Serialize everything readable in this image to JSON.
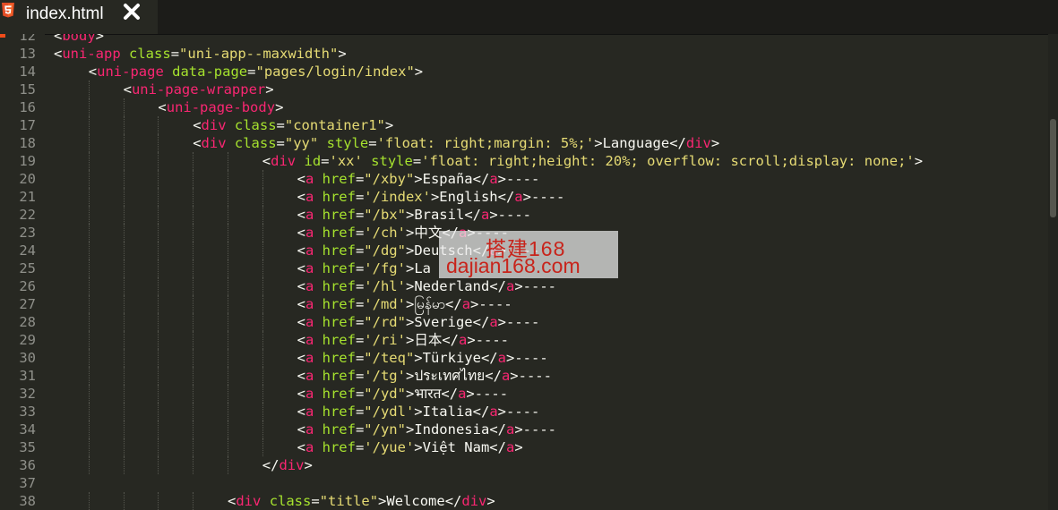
{
  "tab": {
    "title": "index.html",
    "icon": "html5-icon",
    "close_icon": "close-icon"
  },
  "colors": {
    "background": "#272822",
    "tag": "#f92672",
    "attribute": "#a6e22e",
    "string": "#e6db74",
    "text": "#f8f8f2",
    "line_number": "#8f908a"
  },
  "watermark": {
    "line1": "搭建168",
    "line2": "dajian168.com"
  },
  "lines": [
    {
      "n": "12",
      "indent": 0,
      "tokens": [
        [
          "br",
          "<"
        ],
        [
          "tag",
          "body"
        ],
        [
          "br",
          ">"
        ]
      ]
    },
    {
      "n": "13",
      "indent": 0,
      "tokens": [
        [
          "br",
          "<"
        ],
        [
          "tag",
          "uni-app"
        ],
        [
          "t",
          " "
        ],
        [
          "attr",
          "class"
        ],
        [
          "br",
          "="
        ],
        [
          "str",
          "\"uni-app--maxwidth\""
        ],
        [
          "br",
          ">"
        ]
      ]
    },
    {
      "n": "14",
      "indent": 1,
      "tokens": [
        [
          "br",
          "<"
        ],
        [
          "tag",
          "uni-page"
        ],
        [
          "t",
          " "
        ],
        [
          "attr",
          "data-page"
        ],
        [
          "br",
          "="
        ],
        [
          "str",
          "\"pages/login/index\""
        ],
        [
          "br",
          ">"
        ]
      ]
    },
    {
      "n": "15",
      "indent": 2,
      "tokens": [
        [
          "br",
          "<"
        ],
        [
          "tag",
          "uni-page-wrapper"
        ],
        [
          "br",
          ">"
        ]
      ]
    },
    {
      "n": "16",
      "indent": 3,
      "tokens": [
        [
          "br",
          "<"
        ],
        [
          "tag",
          "uni-page-body"
        ],
        [
          "br",
          ">"
        ]
      ]
    },
    {
      "n": "17",
      "indent": 4,
      "tokens": [
        [
          "br",
          "<"
        ],
        [
          "tag",
          "div"
        ],
        [
          "t",
          " "
        ],
        [
          "attr",
          "class"
        ],
        [
          "br",
          "="
        ],
        [
          "str",
          "\"container1\""
        ],
        [
          "br",
          ">"
        ]
      ]
    },
    {
      "n": "18",
      "indent": 4,
      "tokens": [
        [
          "br",
          "<"
        ],
        [
          "tag",
          "div"
        ],
        [
          "t",
          " "
        ],
        [
          "attr",
          "class"
        ],
        [
          "br",
          "="
        ],
        [
          "str",
          "\"yy\""
        ],
        [
          "t",
          " "
        ],
        [
          "attr",
          "style"
        ],
        [
          "br",
          "="
        ],
        [
          "str",
          "'float: right;margin: 5%;'"
        ],
        [
          "br",
          ">"
        ],
        [
          "t",
          "Language"
        ],
        [
          "br",
          "</"
        ],
        [
          "tag",
          "div"
        ],
        [
          "br",
          ">"
        ]
      ]
    },
    {
      "n": "19",
      "indent": 6,
      "tokens": [
        [
          "br",
          "<"
        ],
        [
          "tag",
          "div"
        ],
        [
          "t",
          " "
        ],
        [
          "attr",
          "id"
        ],
        [
          "br",
          "="
        ],
        [
          "str",
          "'xx'"
        ],
        [
          "t",
          " "
        ],
        [
          "attr",
          "style"
        ],
        [
          "br",
          "="
        ],
        [
          "str",
          "'float: right;height: 20%; overflow: scroll;display: none;'"
        ],
        [
          "br",
          ">"
        ]
      ]
    },
    {
      "n": "20",
      "indent": 7,
      "tokens": [
        [
          "br",
          "<"
        ],
        [
          "tag",
          "a"
        ],
        [
          "t",
          " "
        ],
        [
          "attr",
          "href"
        ],
        [
          "br",
          "="
        ],
        [
          "str",
          "\"/xby\""
        ],
        [
          "br",
          ">"
        ],
        [
          "t",
          "España"
        ],
        [
          "br",
          "</"
        ],
        [
          "tag",
          "a"
        ],
        [
          "br",
          ">"
        ],
        [
          "t",
          "----"
        ]
      ]
    },
    {
      "n": "21",
      "indent": 7,
      "tokens": [
        [
          "br",
          "<"
        ],
        [
          "tag",
          "a"
        ],
        [
          "t",
          " "
        ],
        [
          "attr",
          "href"
        ],
        [
          "br",
          "="
        ],
        [
          "str",
          "'/index'"
        ],
        [
          "br",
          ">"
        ],
        [
          "t",
          "English"
        ],
        [
          "br",
          "</"
        ],
        [
          "tag",
          "a"
        ],
        [
          "br",
          ">"
        ],
        [
          "t",
          "----"
        ]
      ]
    },
    {
      "n": "22",
      "indent": 7,
      "tokens": [
        [
          "br",
          "<"
        ],
        [
          "tag",
          "a"
        ],
        [
          "t",
          " "
        ],
        [
          "attr",
          "href"
        ],
        [
          "br",
          "="
        ],
        [
          "str",
          "\"/bx\""
        ],
        [
          "br",
          ">"
        ],
        [
          "t",
          "Brasil"
        ],
        [
          "br",
          "</"
        ],
        [
          "tag",
          "a"
        ],
        [
          "br",
          ">"
        ],
        [
          "t",
          "----"
        ]
      ]
    },
    {
      "n": "23",
      "indent": 7,
      "tokens": [
        [
          "br",
          "<"
        ],
        [
          "tag",
          "a"
        ],
        [
          "t",
          " "
        ],
        [
          "attr",
          "href"
        ],
        [
          "br",
          "="
        ],
        [
          "str",
          "'/ch'"
        ],
        [
          "br",
          ">"
        ],
        [
          "t",
          "中文"
        ],
        [
          "br",
          "</"
        ],
        [
          "tag",
          "a"
        ],
        [
          "br",
          ">"
        ],
        [
          "t",
          "----"
        ]
      ]
    },
    {
      "n": "24",
      "indent": 7,
      "tokens": [
        [
          "br",
          "<"
        ],
        [
          "tag",
          "a"
        ],
        [
          "t",
          " "
        ],
        [
          "attr",
          "href"
        ],
        [
          "br",
          "="
        ],
        [
          "str",
          "\"/dg\""
        ],
        [
          "br",
          ">"
        ],
        [
          "t",
          "Deutsch"
        ],
        [
          "br",
          "</"
        ],
        [
          "tag",
          "a"
        ],
        [
          "br",
          ">"
        ],
        [
          "t",
          "----"
        ]
      ]
    },
    {
      "n": "25",
      "indent": 7,
      "tokens": [
        [
          "br",
          "<"
        ],
        [
          "tag",
          "a"
        ],
        [
          "t",
          " "
        ],
        [
          "attr",
          "href"
        ],
        [
          "br",
          "="
        ],
        [
          "str",
          "'/fg'"
        ],
        [
          "br",
          ">"
        ],
        [
          "t",
          "La"
        ]
      ]
    },
    {
      "n": "26",
      "indent": 7,
      "tokens": [
        [
          "br",
          "<"
        ],
        [
          "tag",
          "a"
        ],
        [
          "t",
          " "
        ],
        [
          "attr",
          "href"
        ],
        [
          "br",
          "="
        ],
        [
          "str",
          "'/hl'"
        ],
        [
          "br",
          ">"
        ],
        [
          "t",
          "Nederland"
        ],
        [
          "br",
          "</"
        ],
        [
          "tag",
          "a"
        ],
        [
          "br",
          ">"
        ],
        [
          "t",
          "----"
        ]
      ]
    },
    {
      "n": "27",
      "indent": 7,
      "tokens": [
        [
          "br",
          "<"
        ],
        [
          "tag",
          "a"
        ],
        [
          "t",
          " "
        ],
        [
          "attr",
          "href"
        ],
        [
          "br",
          "="
        ],
        [
          "str",
          "'/md'"
        ],
        [
          "br",
          ">"
        ],
        [
          "t",
          "မြန်မာ"
        ],
        [
          "br",
          "</"
        ],
        [
          "tag",
          "a"
        ],
        [
          "br",
          ">"
        ],
        [
          "t",
          "----"
        ]
      ]
    },
    {
      "n": "28",
      "indent": 7,
      "tokens": [
        [
          "br",
          "<"
        ],
        [
          "tag",
          "a"
        ],
        [
          "t",
          " "
        ],
        [
          "attr",
          "href"
        ],
        [
          "br",
          "="
        ],
        [
          "str",
          "\"/rd\""
        ],
        [
          "br",
          ">"
        ],
        [
          "t",
          "Sverige"
        ],
        [
          "br",
          "</"
        ],
        [
          "tag",
          "a"
        ],
        [
          "br",
          ">"
        ],
        [
          "t",
          "----"
        ]
      ]
    },
    {
      "n": "29",
      "indent": 7,
      "tokens": [
        [
          "br",
          "<"
        ],
        [
          "tag",
          "a"
        ],
        [
          "t",
          " "
        ],
        [
          "attr",
          "href"
        ],
        [
          "br",
          "="
        ],
        [
          "str",
          "'/ri'"
        ],
        [
          "br",
          ">"
        ],
        [
          "t",
          "日本"
        ],
        [
          "br",
          "</"
        ],
        [
          "tag",
          "a"
        ],
        [
          "br",
          ">"
        ],
        [
          "t",
          "----"
        ]
      ]
    },
    {
      "n": "30",
      "indent": 7,
      "tokens": [
        [
          "br",
          "<"
        ],
        [
          "tag",
          "a"
        ],
        [
          "t",
          " "
        ],
        [
          "attr",
          "href"
        ],
        [
          "br",
          "="
        ],
        [
          "str",
          "\"/teq\""
        ],
        [
          "br",
          ">"
        ],
        [
          "t",
          "Türkiye"
        ],
        [
          "br",
          "</"
        ],
        [
          "tag",
          "a"
        ],
        [
          "br",
          ">"
        ],
        [
          "t",
          "----"
        ]
      ]
    },
    {
      "n": "31",
      "indent": 7,
      "tokens": [
        [
          "br",
          "<"
        ],
        [
          "tag",
          "a"
        ],
        [
          "t",
          " "
        ],
        [
          "attr",
          "href"
        ],
        [
          "br",
          "="
        ],
        [
          "str",
          "'/tg'"
        ],
        [
          "br",
          ">"
        ],
        [
          "t",
          "ประเทศไทย"
        ],
        [
          "br",
          "</"
        ],
        [
          "tag",
          "a"
        ],
        [
          "br",
          ">"
        ],
        [
          "t",
          "----"
        ]
      ]
    },
    {
      "n": "32",
      "indent": 7,
      "tokens": [
        [
          "br",
          "<"
        ],
        [
          "tag",
          "a"
        ],
        [
          "t",
          " "
        ],
        [
          "attr",
          "href"
        ],
        [
          "br",
          "="
        ],
        [
          "str",
          "\"/yd\""
        ],
        [
          "br",
          ">"
        ],
        [
          "t",
          "भारत"
        ],
        [
          "br",
          "</"
        ],
        [
          "tag",
          "a"
        ],
        [
          "br",
          ">"
        ],
        [
          "t",
          "----"
        ]
      ]
    },
    {
      "n": "33",
      "indent": 7,
      "tokens": [
        [
          "br",
          "<"
        ],
        [
          "tag",
          "a"
        ],
        [
          "t",
          " "
        ],
        [
          "attr",
          "href"
        ],
        [
          "br",
          "="
        ],
        [
          "str",
          "\"/ydl'"
        ],
        [
          "br",
          ">"
        ],
        [
          "t",
          "Italia"
        ],
        [
          "br",
          "</"
        ],
        [
          "tag",
          "a"
        ],
        [
          "br",
          ">"
        ],
        [
          "t",
          "----"
        ]
      ]
    },
    {
      "n": "34",
      "indent": 7,
      "tokens": [
        [
          "br",
          "<"
        ],
        [
          "tag",
          "a"
        ],
        [
          "t",
          " "
        ],
        [
          "attr",
          "href"
        ],
        [
          "br",
          "="
        ],
        [
          "str",
          "\"/yn\""
        ],
        [
          "br",
          ">"
        ],
        [
          "t",
          "Indonesia"
        ],
        [
          "br",
          "</"
        ],
        [
          "tag",
          "a"
        ],
        [
          "br",
          ">"
        ],
        [
          "t",
          "----"
        ]
      ]
    },
    {
      "n": "35",
      "indent": 7,
      "tokens": [
        [
          "br",
          "<"
        ],
        [
          "tag",
          "a"
        ],
        [
          "t",
          " "
        ],
        [
          "attr",
          "href"
        ],
        [
          "br",
          "="
        ],
        [
          "str",
          "'/yue'"
        ],
        [
          "br",
          ">"
        ],
        [
          "t",
          "Việt Nam"
        ],
        [
          "br",
          "</"
        ],
        [
          "tag",
          "a"
        ],
        [
          "br",
          ">"
        ]
      ]
    },
    {
      "n": "36",
      "indent": 6,
      "tokens": [
        [
          "br",
          "</"
        ],
        [
          "tag",
          "div"
        ],
        [
          "br",
          ">"
        ]
      ]
    },
    {
      "n": "37",
      "indent": 0,
      "tokens": []
    },
    {
      "n": "38",
      "indent": 5,
      "tokens": [
        [
          "br",
          "<"
        ],
        [
          "tag",
          "div"
        ],
        [
          "t",
          " "
        ],
        [
          "attr",
          "class"
        ],
        [
          "br",
          "="
        ],
        [
          "str",
          "\"title\""
        ],
        [
          "br",
          ">"
        ],
        [
          "t",
          "Welcome"
        ],
        [
          "br",
          "</"
        ],
        [
          "tag",
          "div"
        ],
        [
          "br",
          ">"
        ]
      ]
    }
  ]
}
